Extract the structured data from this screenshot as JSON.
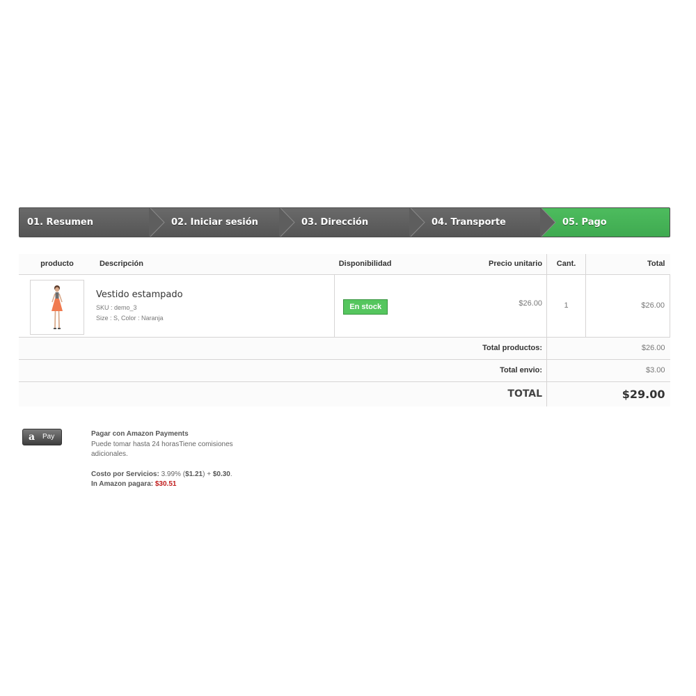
{
  "steps": [
    {
      "label": "01. Resumen"
    },
    {
      "label": "02. Iniciar sesión"
    },
    {
      "label": "03. Dirección"
    },
    {
      "label": "04. Transporte"
    },
    {
      "label": "05. Pago"
    }
  ],
  "active_step_color": "#46b157",
  "cart": {
    "headers": {
      "product": "producto",
      "description": "Descripción",
      "availability": "Disponibilidad",
      "unit_price": "Precio unitario",
      "qty": "Cant.",
      "total": "Total"
    },
    "item": {
      "image_icon": "dress-model-thumbnail",
      "name": "Vestido estampado",
      "sku": "SKU : demo_3",
      "attributes": "Size : S, Color : Naranja",
      "availability": "En stock",
      "unit_price": "$26.00",
      "qty": "1",
      "total": "$26.00"
    },
    "summary": {
      "products_label": "Total productos:",
      "products_value": "$26.00",
      "shipping_label": "Total envio:",
      "shipping_value": "$3.00",
      "total_label": "TOTAL",
      "total_value": "$29.00"
    }
  },
  "payment": {
    "button_icon": "amazon-a-icon",
    "button_text": "Pay",
    "title": "Pagar con Amazon Payments",
    "description": "Puede tomar hasta 24 horasTiene comisiones adicionales.",
    "fee_label": "Costo por Servicios:",
    "fee_percent": "3.99%",
    "fee_amount": "$1.21",
    "fee_fixed": "$0.30",
    "pay_label": "In Amazon pagara:",
    "pay_value": "$30.51",
    "accent_red": "#c01b1b"
  }
}
